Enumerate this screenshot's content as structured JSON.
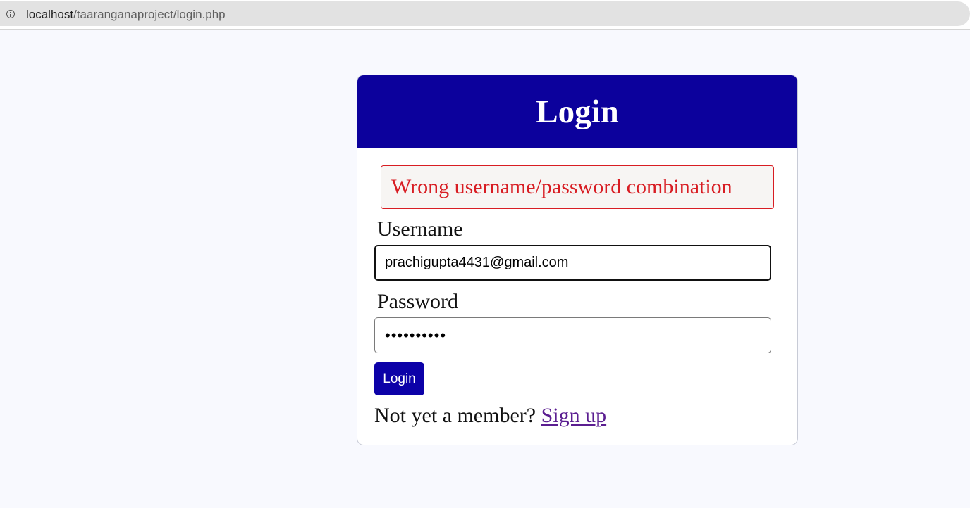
{
  "browser": {
    "url_host": "localhost",
    "url_path": "/taaranganaproject/login.php",
    "info_icon": "info-circle-icon"
  },
  "login_card": {
    "title": "Login",
    "error_message": "Wrong username/password combination",
    "username": {
      "label": "Username",
      "value": "prachigupta4431@gmail.com"
    },
    "password": {
      "label": "Password",
      "value": "••••••••••"
    },
    "login_button": "Login",
    "signup_prompt": "Not yet a member?",
    "signup_link": "Sign up"
  },
  "colors": {
    "header": "#0c019c",
    "button": "#0c01a8",
    "error": "#d81d23",
    "link": "#5b1e91",
    "page_background": "#f8f9fe"
  }
}
